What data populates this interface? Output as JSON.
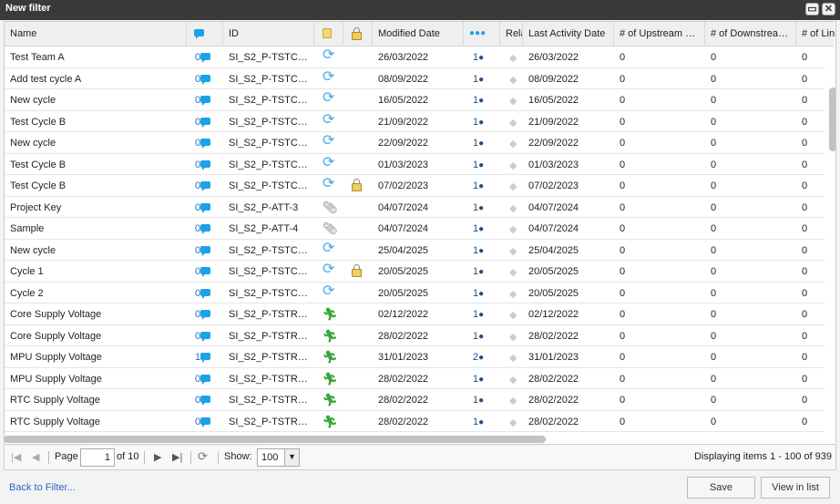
{
  "window": {
    "title": "New filter",
    "maximize_icon": "maximize-icon",
    "close_icon": "close-icon"
  },
  "columns": {
    "name": "Name",
    "comments": "comments-icon",
    "id": "ID",
    "type": "type-icon",
    "lock": "lock-icon",
    "modified": "Modified Date",
    "users": "users-icon",
    "rel": "Rela",
    "last_activity": "Last Activity Date",
    "upstream": "# of Upstream …",
    "downstream": "# of Downstrea…",
    "links": "# of Link"
  },
  "rows": [
    {
      "name": "Test Team A",
      "comments": "0",
      "id": "SI_S2_P-TSTC…",
      "type": "sync",
      "lock": false,
      "modified": "26/03/2022",
      "users": "1",
      "last": "26/03/2022",
      "up": "0",
      "down": "0",
      "links": "0"
    },
    {
      "name": "Add test cycle A",
      "comments": "0",
      "id": "SI_S2_P-TSTC…",
      "type": "sync",
      "lock": false,
      "modified": "08/09/2022",
      "users": "1",
      "last": "08/09/2022",
      "up": "0",
      "down": "0",
      "links": "0"
    },
    {
      "name": "New cycle",
      "comments": "0",
      "id": "SI_S2_P-TSTC…",
      "type": "sync",
      "lock": false,
      "modified": "16/05/2022",
      "users": "1",
      "last": "16/05/2022",
      "up": "0",
      "down": "0",
      "links": "0"
    },
    {
      "name": "Test Cycle B",
      "comments": "0",
      "id": "SI_S2_P-TSTC…",
      "type": "sync",
      "lock": false,
      "modified": "21/09/2022",
      "users": "1",
      "last": "21/09/2022",
      "up": "0",
      "down": "0",
      "links": "0"
    },
    {
      "name": "New cycle",
      "comments": "0",
      "id": "SI_S2_P-TSTC…",
      "type": "sync",
      "lock": false,
      "modified": "22/09/2022",
      "users": "1",
      "last": "22/09/2022",
      "up": "0",
      "down": "0",
      "links": "0"
    },
    {
      "name": "Test Cycle B",
      "comments": "0",
      "id": "SI_S2_P-TSTC…",
      "type": "sync",
      "lock": false,
      "modified": "01/03/2023",
      "users": "1",
      "last": "01/03/2023",
      "up": "0",
      "down": "0",
      "links": "0"
    },
    {
      "name": "Test Cycle B",
      "comments": "0",
      "id": "SI_S2_P-TSTC…",
      "type": "sync",
      "lock": true,
      "modified": "07/02/2023",
      "users": "1",
      "last": "07/02/2023",
      "up": "0",
      "down": "0",
      "links": "0"
    },
    {
      "name": "Project Key",
      "comments": "0",
      "id": "SI_S2_P-ATT-3",
      "type": "attachment",
      "lock": false,
      "modified": "04/07/2024",
      "users": "1",
      "last": "04/07/2024",
      "up": "0",
      "down": "0",
      "links": "0"
    },
    {
      "name": "Sample",
      "comments": "0",
      "id": "SI_S2_P-ATT-4",
      "type": "attachment",
      "lock": false,
      "modified": "04/07/2024",
      "users": "1",
      "last": "04/07/2024",
      "up": "0",
      "down": "0",
      "links": "0"
    },
    {
      "name": "New cycle",
      "comments": "0",
      "id": "SI_S2_P-TSTC…",
      "type": "sync",
      "lock": false,
      "modified": "25/04/2025",
      "users": "1",
      "last": "25/04/2025",
      "up": "0",
      "down": "0",
      "links": "0"
    },
    {
      "name": "Cycle 1",
      "comments": "0",
      "id": "SI_S2_P-TSTC…",
      "type": "sync",
      "lock": true,
      "modified": "20/05/2025",
      "users": "1",
      "last": "20/05/2025",
      "up": "0",
      "down": "0",
      "links": "0"
    },
    {
      "name": "Cycle 2",
      "comments": "0",
      "id": "SI_S2_P-TSTC…",
      "type": "sync",
      "lock": false,
      "modified": "20/05/2025",
      "users": "1",
      "last": "20/05/2025",
      "up": "0",
      "down": "0",
      "links": "0"
    },
    {
      "name": "Core Supply Voltage",
      "comments": "0",
      "id": "SI_S2_P-TSTR…",
      "type": "run",
      "lock": false,
      "modified": "02/12/2022",
      "users": "1",
      "last": "02/12/2022",
      "up": "0",
      "down": "0",
      "links": "0"
    },
    {
      "name": "Core Supply Voltage",
      "comments": "0",
      "id": "SI_S2_P-TSTR…",
      "type": "run",
      "lock": false,
      "modified": "28/02/2022",
      "users": "1",
      "last": "28/02/2022",
      "up": "0",
      "down": "0",
      "links": "0"
    },
    {
      "name": "MPU Supply Voltage",
      "comments": "1",
      "id": "SI_S2_P-TSTR…",
      "type": "run",
      "lock": false,
      "modified": "31/01/2023",
      "users": "2",
      "last": "31/01/2023",
      "up": "0",
      "down": "0",
      "links": "0"
    },
    {
      "name": "MPU Supply Voltage",
      "comments": "0",
      "id": "SI_S2_P-TSTR…",
      "type": "run",
      "lock": false,
      "modified": "28/02/2022",
      "users": "1",
      "last": "28/02/2022",
      "up": "0",
      "down": "0",
      "links": "0"
    },
    {
      "name": "RTC Supply Voltage",
      "comments": "0",
      "id": "SI_S2_P-TSTR…",
      "type": "run",
      "lock": false,
      "modified": "28/02/2022",
      "users": "1",
      "last": "28/02/2022",
      "up": "0",
      "down": "0",
      "links": "0"
    },
    {
      "name": "RTC Supply Voltage",
      "comments": "0",
      "id": "SI_S2_P-TSTR…",
      "type": "run",
      "lock": false,
      "modified": "28/02/2022",
      "users": "1",
      "last": "28/02/2022",
      "up": "0",
      "down": "0",
      "links": "0"
    }
  ],
  "pager": {
    "page_label": "Page",
    "page": "1",
    "of_label": "of 10",
    "show_label": "Show:",
    "page_size": "100",
    "status": "Displaying items 1 - 100 of 939"
  },
  "footer": {
    "back_link": "Back to Filter...",
    "save": "Save",
    "view_in_list": "View in list"
  }
}
